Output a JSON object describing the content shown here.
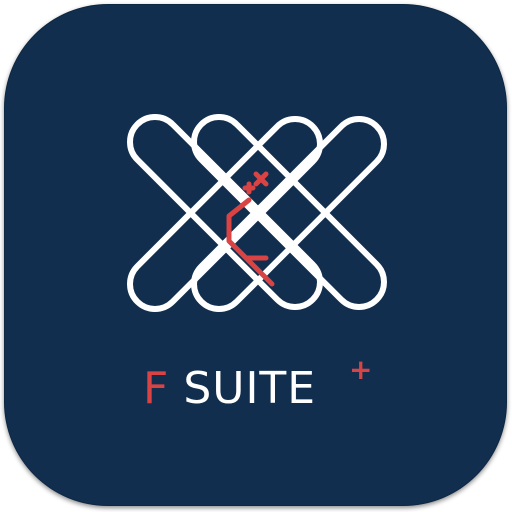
{
  "app_icon": {
    "background_color": "#112e4e",
    "outline_color": "#ffffff",
    "accent_color": "#d94344"
  },
  "wordmark": {
    "letter": "F",
    "name": "SUITE",
    "plus": "+"
  }
}
